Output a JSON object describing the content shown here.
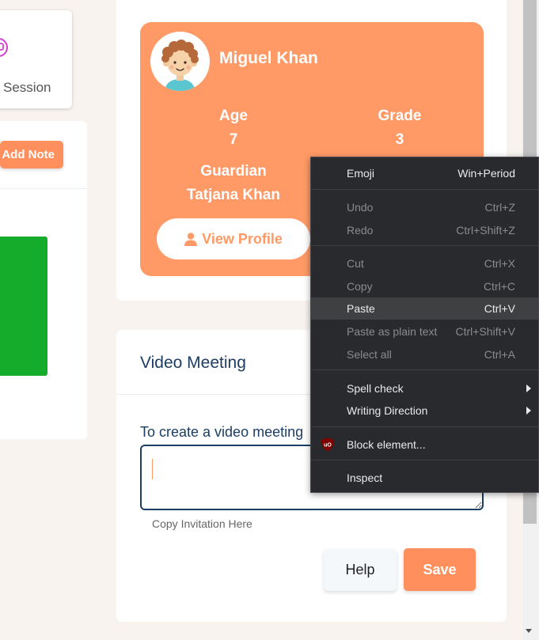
{
  "left_panel": {
    "session_label": "Session",
    "add_note_label": "Add Note"
  },
  "student": {
    "name": "Miguel Khan",
    "age_label": "Age",
    "age_value": "7",
    "grade_label": "Grade",
    "grade_value": "3",
    "guardian_label": "Guardian",
    "guardian_value": "Tatjana Khan",
    "view_profile_label": "View Profile",
    "card_color": "#ff9966"
  },
  "video_meeting": {
    "title": "Video Meeting",
    "instructions": "To create a video meeting",
    "helper_text": "Copy Invitation Here",
    "help_label": "Help",
    "save_label": "Save"
  },
  "context_menu": {
    "emoji": {
      "label": "Emoji",
      "shortcut": "Win+Period"
    },
    "undo": {
      "label": "Undo",
      "shortcut": "Ctrl+Z"
    },
    "redo": {
      "label": "Redo",
      "shortcut": "Ctrl+Shift+Z"
    },
    "cut": {
      "label": "Cut",
      "shortcut": "Ctrl+X"
    },
    "copy": {
      "label": "Copy",
      "shortcut": "Ctrl+C"
    },
    "paste": {
      "label": "Paste",
      "shortcut": "Ctrl+V"
    },
    "paste_plain": {
      "label": "Paste as plain text",
      "shortcut": "Ctrl+Shift+V"
    },
    "select_all": {
      "label": "Select all",
      "shortcut": "Ctrl+A"
    },
    "spell_check": {
      "label": "Spell check"
    },
    "writing_direction": {
      "label": "Writing Direction"
    },
    "block_element": {
      "label": "Block element..."
    },
    "inspect": {
      "label": "Inspect"
    }
  },
  "colors": {
    "accent": "#ff8f5c",
    "navy": "#1c3d64",
    "green": "#15ac2c",
    "menu_bg": "#292a2d"
  }
}
